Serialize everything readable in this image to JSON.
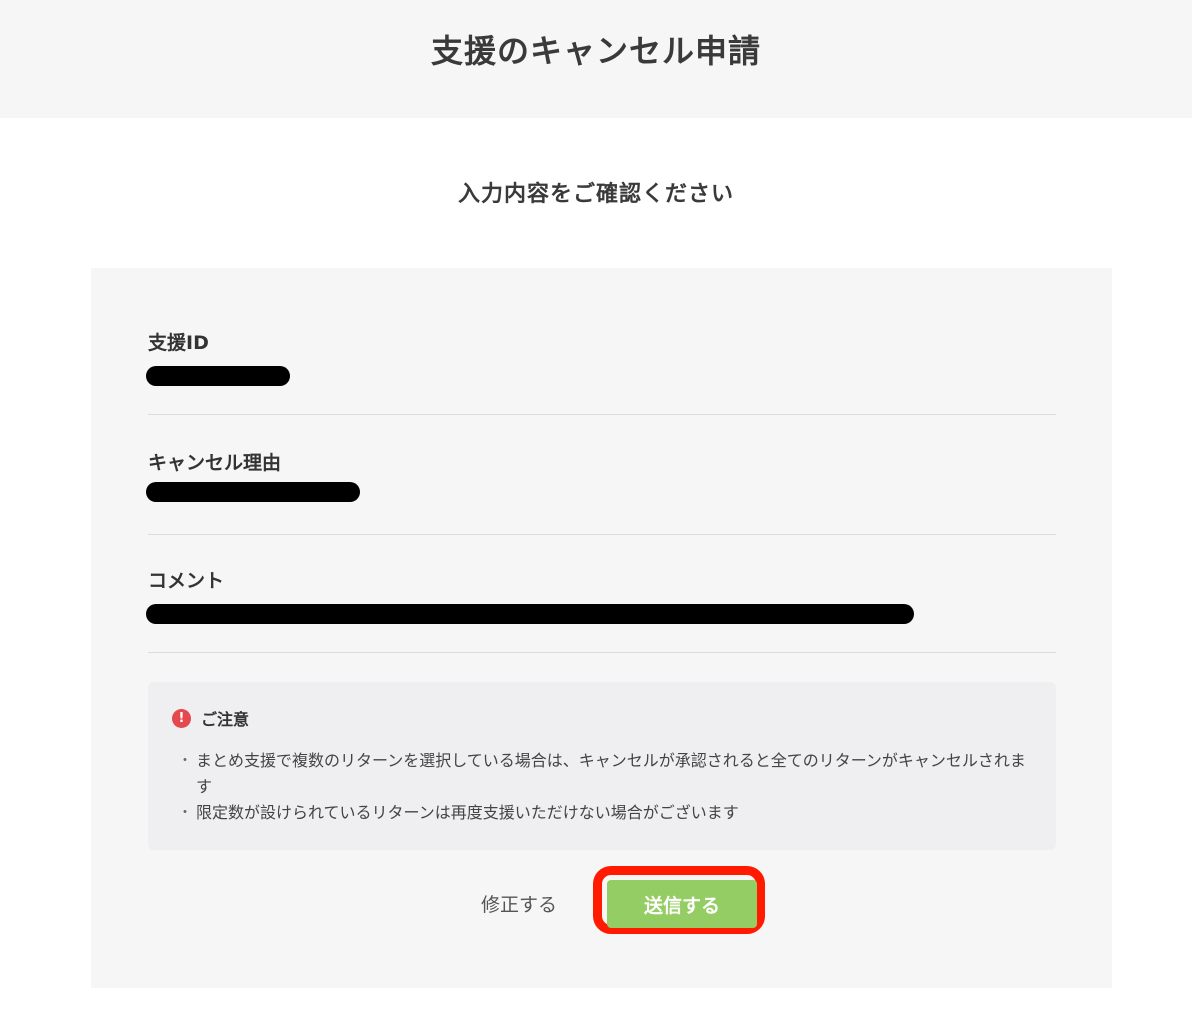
{
  "header": {
    "title": "支援のキャンセル申請"
  },
  "subtitle": "入力内容をご確認ください",
  "fields": [
    {
      "label": "支援ID"
    },
    {
      "label": "キャンセル理由"
    },
    {
      "label": "コメント"
    }
  ],
  "notice": {
    "icon": "alert-circle-icon",
    "icon_glyph": "!",
    "title": "ご注意",
    "items": [
      "まとめ支援で複数のリターンを選択している場合は、キャンセルが承認されると全てのリターンがキャンセルされます",
      "限定数が設けられているリターンは再度支援いただけない場合がございます"
    ],
    "bullet": "・"
  },
  "actions": {
    "edit_label": "修正する",
    "submit_label": "送信する"
  },
  "colors": {
    "submit": "#94cd63",
    "highlight": "#ff1a00",
    "alert": "#e5484d"
  }
}
